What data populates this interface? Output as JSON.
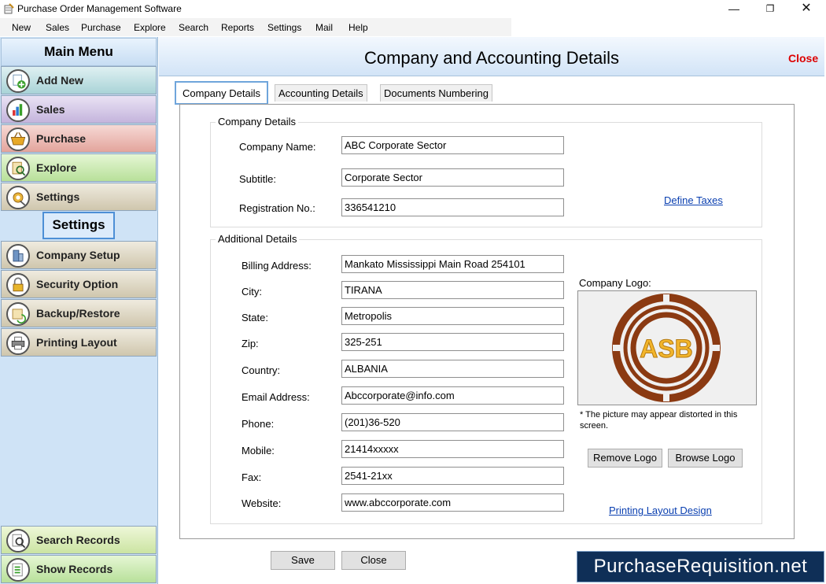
{
  "window": {
    "title": "Purchase Order Management Software",
    "minimize_glyph": "—",
    "maximize_glyph": "❐",
    "close_glyph": "✕"
  },
  "menubar": [
    "New",
    "Sales",
    "Purchase",
    "Explore",
    "Search",
    "Reports",
    "Settings",
    "Mail",
    "Help"
  ],
  "sidebar": {
    "main_menu_title": "Main Menu",
    "main_items": [
      {
        "label": "Add New",
        "icon": "add-new-icon"
      },
      {
        "label": "Sales",
        "icon": "sales-chart-icon"
      },
      {
        "label": "Purchase",
        "icon": "purchase-basket-icon"
      },
      {
        "label": "Explore",
        "icon": "explore-icon"
      },
      {
        "label": "Settings",
        "icon": "settings-icon"
      }
    ],
    "settings_title": "Settings",
    "settings_items": [
      {
        "label": "Company Setup",
        "icon": "company-setup-icon"
      },
      {
        "label": "Security Option",
        "icon": "lock-icon"
      },
      {
        "label": "Backup/Restore",
        "icon": "backup-icon"
      },
      {
        "label": "Printing Layout",
        "icon": "printer-icon"
      }
    ],
    "bottom_items": [
      {
        "label": "Search Records",
        "icon": "search-records-icon"
      },
      {
        "label": "Show Records",
        "icon": "show-records-icon"
      }
    ]
  },
  "main": {
    "title": "Company and Accounting Details",
    "close_label": "Close",
    "tabs": [
      "Company Details",
      "Accounting Details",
      "Documents Numbering"
    ],
    "active_tab": "Company Details",
    "company_details": {
      "group_title": "Company Details",
      "fields": [
        {
          "label": "Company Name:",
          "value": "ABC Corporate Sector"
        },
        {
          "label": "Subtitle:",
          "value": "Corporate Sector"
        },
        {
          "label": "Registration No.:",
          "value": "336541210"
        }
      ],
      "define_taxes_link": "Define Taxes"
    },
    "additional_details": {
      "group_title": "Additional Details",
      "fields": [
        {
          "label": "Billing Address:",
          "value": "Mankato Mississippi Main Road 254101"
        },
        {
          "label": "City:",
          "value": "TIRANA"
        },
        {
          "label": "State:",
          "value": "Metropolis"
        },
        {
          "label": "Zip:",
          "value": "325-251"
        },
        {
          "label": "Country:",
          "value": "ALBANIA"
        },
        {
          "label": "Email Address:",
          "value": "Abccorporate@info.com"
        },
        {
          "label": "Phone:",
          "value": "(201)36-520"
        },
        {
          "label": "Mobile:",
          "value": "21414xxxxx"
        },
        {
          "label": "Fax:",
          "value": "2541-21xx"
        },
        {
          "label": "Website:",
          "value": "www.abccorporate.com"
        }
      ],
      "logo_label": "Company Logo:",
      "logo_text": "ASB",
      "logo_note": "* The picture may appear distorted in this screen.",
      "remove_logo_label": "Remove Logo",
      "browse_logo_label": "Browse Logo",
      "printing_layout_link": "Printing Layout Design"
    },
    "save_label": "Save",
    "close_button_label": "Close"
  },
  "watermark": "PurchaseRequisition.net",
  "colors": {
    "sidebar_bg": "#cfe3f6",
    "accent_blue": "#4d8fd6",
    "close_red": "#dd0000",
    "link_blue": "#0a3fb0",
    "logo_brown": "#8b3a12",
    "logo_gold": "#f2b52b"
  }
}
